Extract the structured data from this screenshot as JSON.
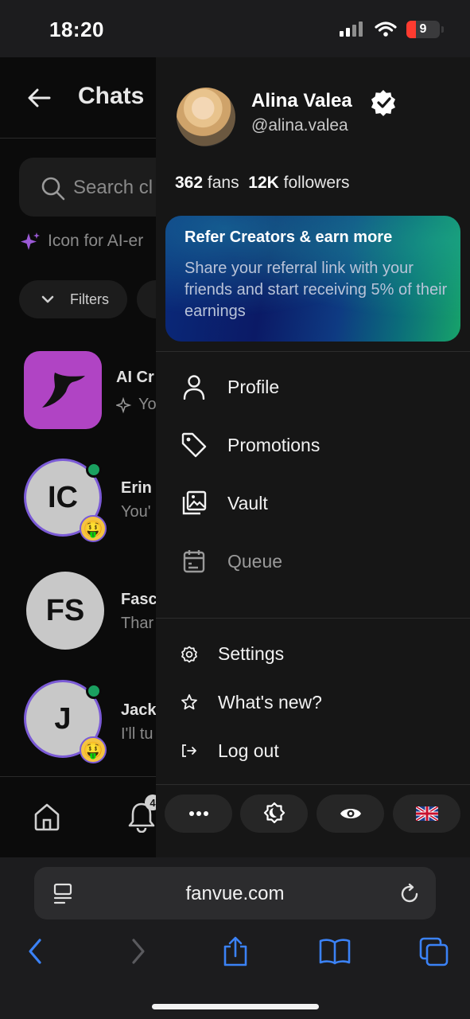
{
  "status_bar": {
    "time": "18:20",
    "battery": "9"
  },
  "chats": {
    "title": "Chats",
    "search_placeholder": "Search cl",
    "ai_note": "Icon for AI-er",
    "filters_label": "Filters",
    "items": [
      {
        "name": "AI Cr",
        "message": "Yo"
      },
      {
        "initials": "IC",
        "name": "Erin",
        "message": "You'"
      },
      {
        "initials": "FS",
        "name": "Fasc",
        "message": "Thar"
      },
      {
        "initials": "J",
        "name": "Jack",
        "message": "I'll tu"
      }
    ],
    "notif_badge": "4"
  },
  "drawer": {
    "name": "Alina Valea",
    "handle": "@alina.valea",
    "fans_count": "362",
    "fans_label": "fans",
    "followers_count": "12K",
    "followers_label": "followers",
    "refer": {
      "title": "Refer Creators & earn more",
      "body": "Share your referral link with your friends and start receiving 5% of their earnings"
    },
    "menu": [
      {
        "label": "Profile",
        "icon": "person-icon"
      },
      {
        "label": "Promotions",
        "icon": "tag-icon"
      },
      {
        "label": "Vault",
        "icon": "images-icon"
      },
      {
        "label": "Queue",
        "icon": "calendar-icon"
      }
    ],
    "secondary_menu": [
      {
        "label": "Settings",
        "icon": "gear-icon"
      },
      {
        "label": "What's new?",
        "icon": "star-icon"
      },
      {
        "label": "Log out",
        "icon": "logout-icon"
      }
    ],
    "quick_buttons": [
      "more-icon",
      "theme-icon",
      "eye-icon",
      "uk-flag-icon"
    ]
  },
  "browser": {
    "url": "fanvue.com"
  },
  "colors": {
    "accent_purple": "#b044c4",
    "online_green": "#1aa060",
    "ring_purple": "#7b5bd6"
  }
}
